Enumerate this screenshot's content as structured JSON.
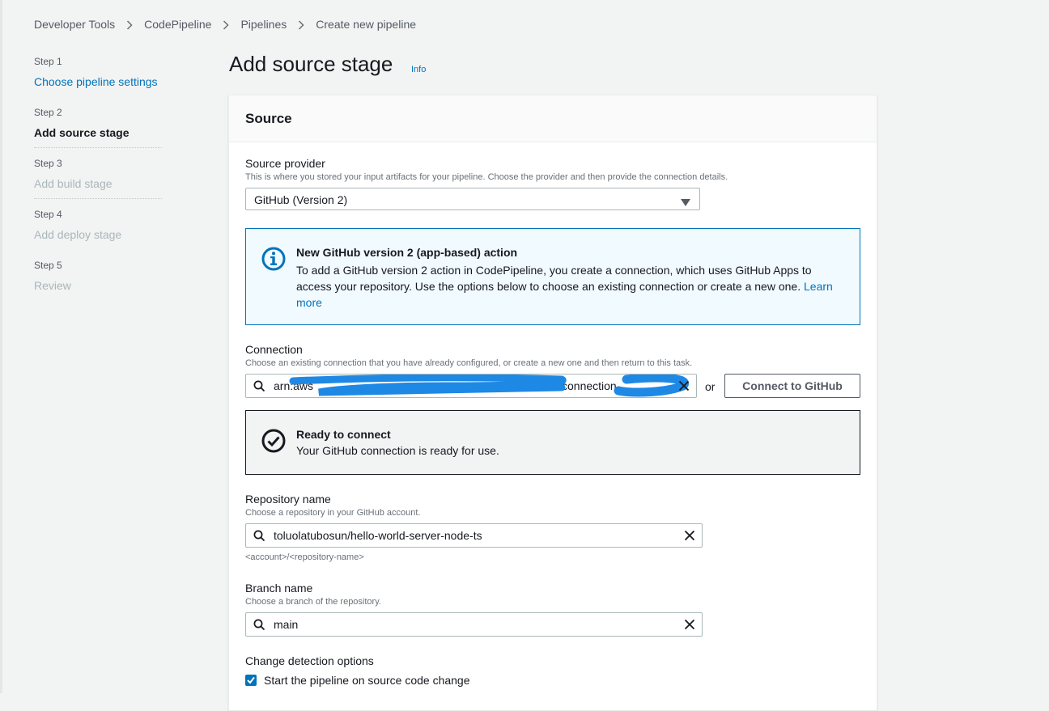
{
  "breadcrumb": [
    {
      "label": "Developer Tools"
    },
    {
      "label": "CodePipeline"
    },
    {
      "label": "Pipelines"
    },
    {
      "label": "Create new pipeline"
    }
  ],
  "steps": [
    {
      "number": "Step 1",
      "title": "Choose pipeline settings",
      "state": "link"
    },
    {
      "number": "Step 2",
      "title": "Add source stage",
      "state": "active"
    },
    {
      "number": "Step 3",
      "title": "Add build stage",
      "state": "disabled"
    },
    {
      "number": "Step 4",
      "title": "Add deploy stage",
      "state": "disabled"
    },
    {
      "number": "Step 5",
      "title": "Review",
      "state": "disabled"
    }
  ],
  "page": {
    "title": "Add source stage",
    "info": "Info"
  },
  "source": {
    "header": "Source",
    "provider": {
      "label": "Source provider",
      "description": "This is where you stored your input artifacts for your pipeline. Choose the provider and then provide the connection details.",
      "value": "GitHub (Version 2)"
    },
    "info_alert": {
      "title": "New GitHub version 2 (app-based) action",
      "body": "To add a GitHub version 2 action in CodePipeline, you create a connection, which uses GitHub Apps to access your repository. Use the options below to choose an existing connection or create a new one.",
      "link": "Learn more"
    },
    "connection": {
      "label": "Connection",
      "description": "Choose an existing connection that you have already configured, or create a new one and then return to this task.",
      "value_prefix": "arn:aws",
      "value_middle": "connection",
      "or": "or",
      "button": "Connect to GitHub"
    },
    "ready_alert": {
      "title": "Ready to connect",
      "body": "Your GitHub connection is ready for use."
    },
    "repository": {
      "label": "Repository name",
      "description": "Choose a repository in your GitHub account.",
      "value": "toluolatubosun/hello-world-server-node-ts",
      "hint": "<account>/<repository-name>"
    },
    "branch": {
      "label": "Branch name",
      "description": "Choose a branch of the repository.",
      "value": "main"
    },
    "change_detection": {
      "label": "Change detection options",
      "checkbox_label": "Start the pipeline on source code change",
      "checked": true
    }
  },
  "colors": {
    "accent": "#0073bb",
    "info_bg": "#f1faff",
    "redaction": "#1e88e5"
  }
}
